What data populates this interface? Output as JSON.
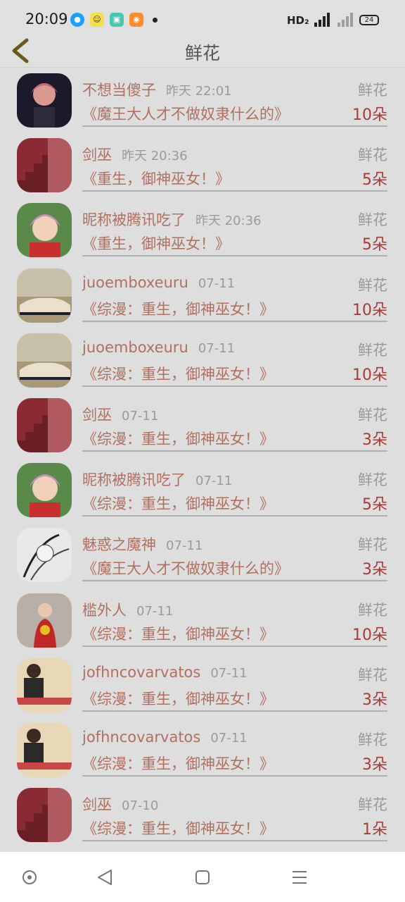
{
  "status_bar": {
    "time": "20:09",
    "network": "HD₂",
    "battery": "24",
    "apps": [
      "qq-icon",
      "smiley-app-icon",
      "green-app-icon",
      "uc-browser-icon"
    ]
  },
  "header": {
    "title": "鲜花",
    "back_icon": "chevron-left-icon"
  },
  "gift_label": "鲜花",
  "rows": [
    {
      "name": "不想当傻子",
      "time": "昨天 22:01",
      "book": "《魔王大人才不做奴隶什么的》",
      "count": "10朵",
      "avatar": "anime-boy-dark"
    },
    {
      "name": "剑巫",
      "time": "昨天 20:36",
      "book": "《重生，御神巫女！》",
      "count": "5朵",
      "avatar": "red-stairs"
    },
    {
      "name": "昵称被腾讯吃了",
      "time": "昨天 20:36",
      "book": "《重生，御神巫女！》",
      "count": "5朵",
      "avatar": "anime-pink-hair"
    },
    {
      "name": "juoemboxeuru",
      "time": "07-11",
      "book": "《综漫：重生，御神巫女！》",
      "count": "10朵",
      "avatar": "sports-car"
    },
    {
      "name": "juoemboxeuru",
      "time": "07-11",
      "book": "《综漫：重生，御神巫女！》",
      "count": "10朵",
      "avatar": "sports-car"
    },
    {
      "name": "剑巫",
      "time": "07-11",
      "book": "《综漫：重生，御神巫女！》",
      "count": "3朵",
      "avatar": "red-stairs"
    },
    {
      "name": "昵称被腾讯吃了",
      "time": "07-11",
      "book": "《综漫：重生，御神巫女！》",
      "count": "5朵",
      "avatar": "anime-pink-hair"
    },
    {
      "name": "魅惑之魔神",
      "time": "07-11",
      "book": "《魔王大人才不做奴隶什么的》",
      "count": "3朵",
      "avatar": "sketch-bw"
    },
    {
      "name": "槛外人",
      "time": "07-11",
      "book": "《综漫：重生，御神巫女！》",
      "count": "10朵",
      "avatar": "bride-red"
    },
    {
      "name": "jofhncovarvatos",
      "time": "07-11",
      "book": "《综漫：重生，御神巫女！》",
      "count": "3朵",
      "avatar": "man-photo"
    },
    {
      "name": "jofhncovarvatos",
      "time": "07-11",
      "book": "《综漫：重生，御神巫女！》",
      "count": "3朵",
      "avatar": "man-photo"
    },
    {
      "name": "剑巫",
      "time": "07-10",
      "book": "《综漫：重生，御神巫女！》",
      "count": "1朵",
      "avatar": "red-stairs"
    }
  ],
  "nav_bar": {
    "buttons": [
      "assistant-icon",
      "back-icon",
      "home-icon",
      "menu-icon"
    ]
  },
  "colors": {
    "name": "#b07060",
    "count": "#a83a3a",
    "meta": "#9a9a9a",
    "background": "#dedede"
  }
}
